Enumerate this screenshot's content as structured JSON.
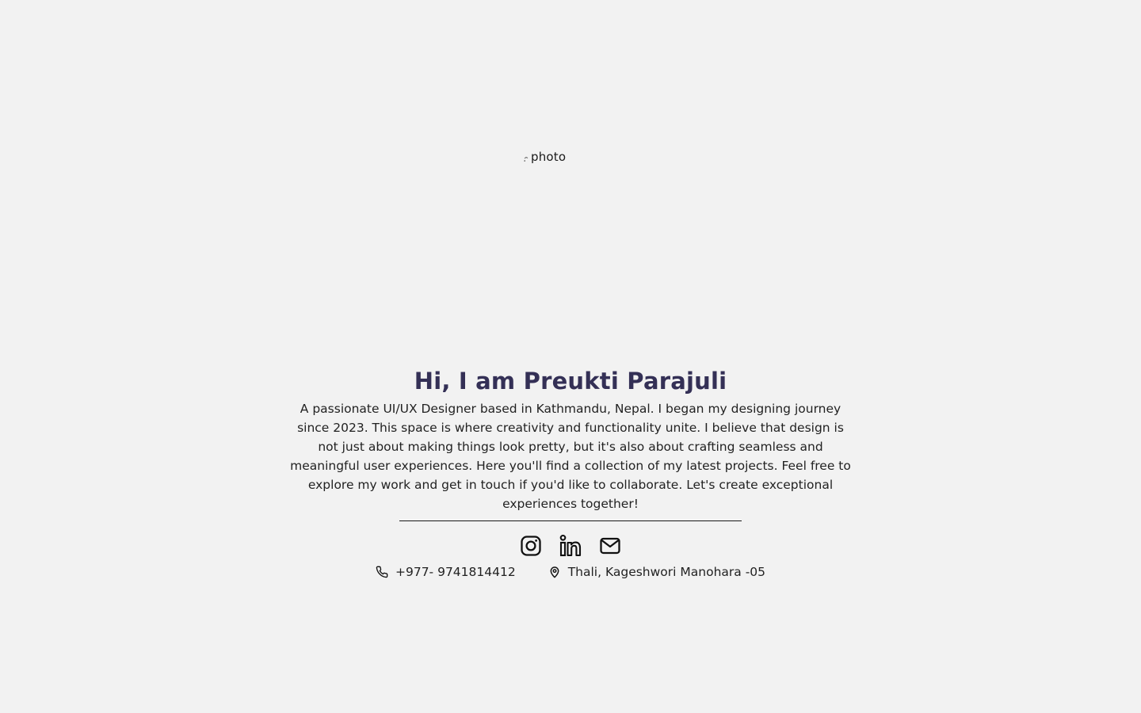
{
  "profile_photo": {
    "alt_text": "photo",
    "icon": "broken-image-icon"
  },
  "hero": {
    "title": "Hi, I am Preukti Parajuli",
    "description": "A passionate UI/UX Designer based in Kathmandu, Nepal. I began my designing journey since 2023. This space is where creativity and functionality unite. I believe that design is not just about making things look pretty, but it's also about crafting seamless and meaningful user experiences. Here you'll find a collection of my latest projects. Feel free to explore my work and get in touch if you'd like to collaborate. Let's create exceptional experiences together!"
  },
  "social": [
    {
      "name": "Instagram",
      "icon": "instagram-icon"
    },
    {
      "name": "LinkedIn",
      "icon": "linkedin-icon"
    },
    {
      "name": "Email",
      "icon": "mail-icon"
    }
  ],
  "contact": {
    "phone": {
      "icon": "phone-icon",
      "text": "+977- 9741814412"
    },
    "location": {
      "icon": "map-pin-icon",
      "text": "Thali, Kageshwori Manohara -05"
    }
  },
  "colors": {
    "background": "#f2f2f2",
    "title": "#343056",
    "body_text": "#222222",
    "icon": "#111111"
  }
}
